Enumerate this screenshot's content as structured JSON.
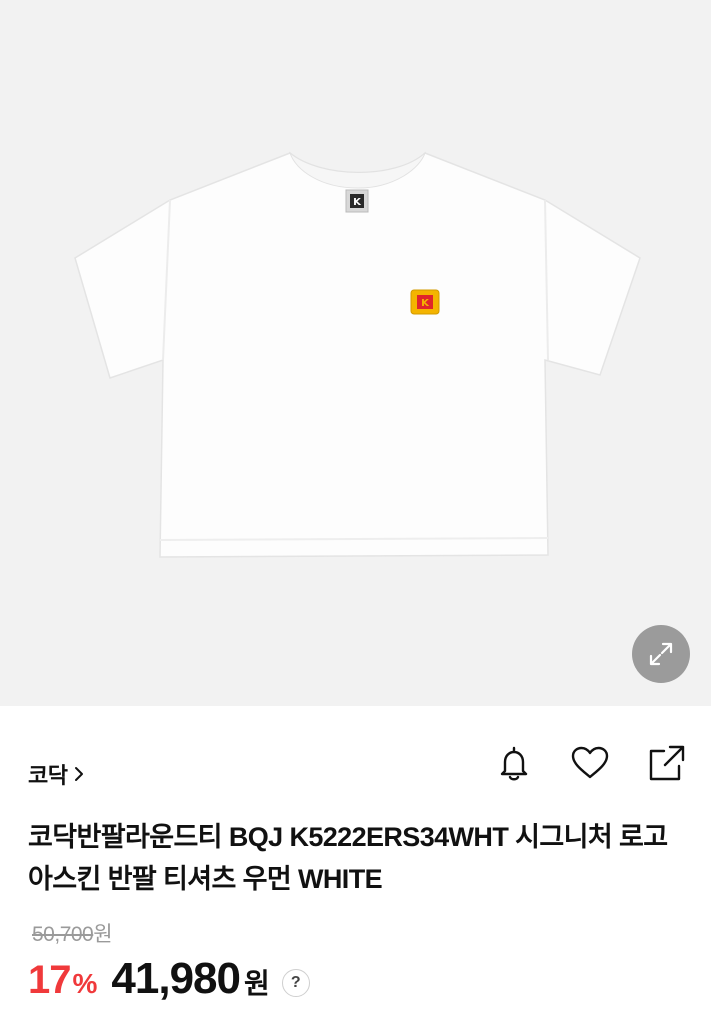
{
  "product_image": {
    "alt": "",
    "label_icon": "kodak-k-logo-icon",
    "patch_icon": "kodak-patch-icon"
  },
  "zoom": {
    "icon": "expand-arrows-icon"
  },
  "brand": {
    "name": "코닥"
  },
  "actions": {
    "notify_icon": "bell-icon",
    "wishlist_icon": "heart-icon",
    "share_icon": "share-icon"
  },
  "product": {
    "title": "코닥반팔라운드티 BQJ K5222ERS34WHT 시그니처 로고 아스킨 반팔 티셔츠 우먼 WHITE"
  },
  "pricing": {
    "original_price": "50,700",
    "original_currency": "원",
    "discount_rate": "17",
    "discount_symbol": "%",
    "sale_price": "41,980",
    "currency": "원",
    "help_label": "?"
  },
  "colors": {
    "discount": "#f0393b",
    "hero_bg": "#f2f2f2",
    "kodak_yellow": "#f4b400",
    "kodak_red": "#e0262a"
  }
}
